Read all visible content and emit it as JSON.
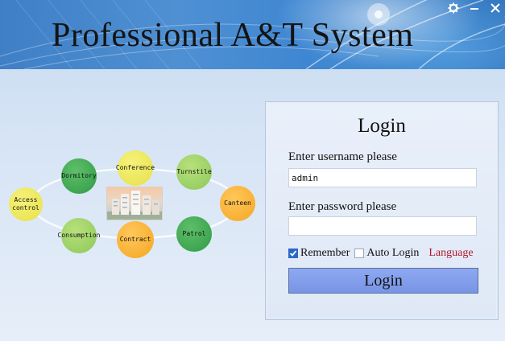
{
  "app": {
    "title": "Professional A&T System"
  },
  "window_controls": [
    {
      "icon": "gear-icon"
    },
    {
      "icon": "minimize-icon"
    },
    {
      "icon": "close-icon"
    }
  ],
  "diagram": {
    "nodes": {
      "access_control": "Access\ncontrol",
      "dormitory": "Dormitory",
      "conference": "Conference",
      "turnstile": "Turnstile",
      "canteen": "Canteen",
      "patrol": "Patrol",
      "contract": "Contract",
      "consumption": "Consumption"
    },
    "colors": {
      "green": "#2f9a45",
      "lime": "#8cc85a",
      "yellow": "#e6e04a",
      "orange": "#f5a623"
    }
  },
  "login": {
    "title": "Login",
    "username_label": "Enter username please",
    "username_value": "admin",
    "password_label": "Enter password please",
    "password_value": "",
    "remember_label": "Remember",
    "remember_checked": true,
    "autologin_label": "Auto Login",
    "autologin_checked": false,
    "language_label": "Language",
    "button_label": "Login"
  },
  "colors": {
    "accent": "#7894e6",
    "header": "#3f87d2",
    "language_link": "#b3182c"
  }
}
